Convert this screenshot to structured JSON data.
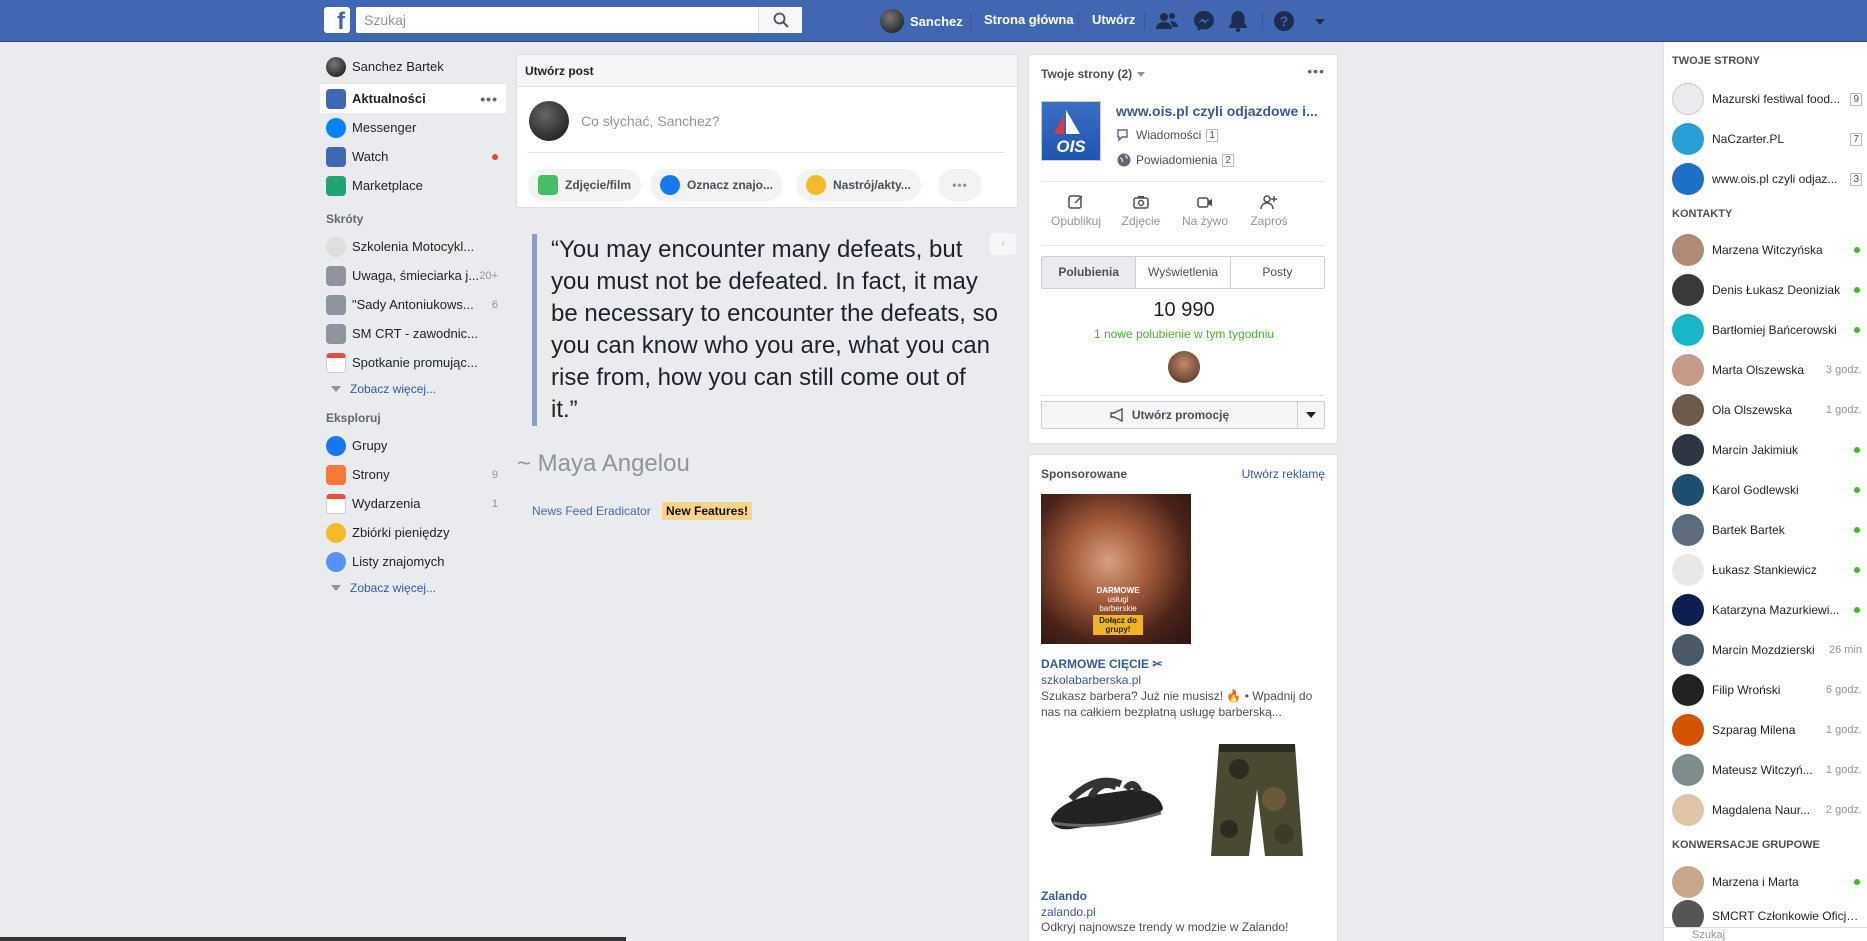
{
  "topbar": {
    "logo": "f",
    "search_placeholder": "Szukaj",
    "user_name": "Sanchez",
    "home": "Strona główna",
    "create": "Utwórz"
  },
  "left_nav": {
    "user": "Sanchez Bartek",
    "main": [
      {
        "label": "Aktualności",
        "more": "•••"
      },
      {
        "label": "Messenger"
      },
      {
        "label": "Watch"
      },
      {
        "label": "Marketplace"
      }
    ],
    "shortcuts_title": "Skróty",
    "shortcuts": [
      {
        "label": "Szkolenia Motocykl...",
        "count": ""
      },
      {
        "label": "Uwaga, śmieciarka j...",
        "count": "20+"
      },
      {
        "label": "\"Sady Antoniukows...",
        "count": "6"
      },
      {
        "label": "SM CRT - zawodnic...",
        "count": ""
      },
      {
        "label": "Spotkanie promując...",
        "count": ""
      }
    ],
    "see_more": "Zobacz więcej...",
    "explore_title": "Eksploruj",
    "explore": [
      {
        "label": "Grupy",
        "count": ""
      },
      {
        "label": "Strony",
        "count": "9"
      },
      {
        "label": "Wydarzenia",
        "count": "1"
      },
      {
        "label": "Zbiórki pieniędzy",
        "count": ""
      },
      {
        "label": "Listy znajomych",
        "count": ""
      }
    ]
  },
  "composer": {
    "title": "Utwórz post",
    "placeholder": "Co słychać, Sanchez?",
    "actions": [
      "Zdjęcie/film",
      "Oznacz znajo...",
      "Nastrój/akty...",
      "•••"
    ]
  },
  "quote": {
    "text": "“You may encounter many defeats, but you must not be defeated. In fact, it may be necessary to encounter the defeats, so you can know who you are, what you can rise from, how you can still come out of it.”",
    "author": "~ Maya Angelou",
    "nfe_link": "News Feed Eradicator",
    "new_features": "New Features!",
    "arrow": "‹"
  },
  "pages_panel": {
    "title": "Twoje strony (2)",
    "page_name": "www.ois.pl czyli odjazdowe i...",
    "messages_label": "Wiadomości",
    "messages_count": "1",
    "notifications_label": "Powiadomienia",
    "notifications_count": "2",
    "actions": [
      "Opublikuj",
      "Zdjęcie",
      "Na żywo",
      "Zaproś"
    ],
    "tabs": [
      "Polubienia",
      "Wyświetlenia",
      "Posty"
    ],
    "likes": "10 990",
    "likes_note": "1 nowe polubienie w tym tygodniu",
    "promote": "Utwórz promocję"
  },
  "ads": {
    "title": "Sponsorowane",
    "create": "Utwórz reklamę",
    "ad1": {
      "title": "DARMOWE CIĘCIE ✂",
      "domain": "szkolabarberska.pl",
      "text": "Szukasz barbera? Już nie musisz! 🔥 • Wpadnij do nas na całkiem bezpłatną usługę barberską...",
      "img_text1": "DARMOWE",
      "img_text2": "usługi",
      "img_text3": "barberskie",
      "img_text4": "Dołącz do grupy!"
    },
    "ad2": {
      "title": "Zalando",
      "domain": "zalando.pl",
      "text": "Odkryj najnowsze trendy w modzie w Zalando!"
    }
  },
  "right_sidebar": {
    "pages_title": "TWOJE STRONY",
    "pages": [
      {
        "name": "Mazurski festiwal food...",
        "count": "9",
        "color": "#e9ebee"
      },
      {
        "name": "NaCzarter.PL",
        "count": "7",
        "color": "#2a9fd6"
      },
      {
        "name": "www.ois.pl czyli odjaz...",
        "count": "3",
        "color": "#1e6fc7"
      }
    ],
    "contacts_title": "KONTAKTY",
    "contacts": [
      {
        "name": "Marzena Witczyńska",
        "time": "",
        "color": "#b08a73"
      },
      {
        "name": "Denis Łukasz Deoniziak",
        "time": "",
        "color": "#3a3a3a"
      },
      {
        "name": "Bartłomiej Bańcerowski",
        "time": "",
        "color": "#19b5c9"
      },
      {
        "name": "Marta Olszewska",
        "time": "3 godz.",
        "color": "#c59a86"
      },
      {
        "name": "Ola Olszewska",
        "time": "1 godz.",
        "color": "#6d5a4a"
      },
      {
        "name": "Marcin Jakimiuk",
        "time": "",
        "color": "#2f3542"
      },
      {
        "name": "Karol Godlewski",
        "time": "",
        "color": "#1e4e6f"
      },
      {
        "name": "Bartek Bartek",
        "time": "",
        "color": "#5d6d7e"
      },
      {
        "name": "Łukasz Stankiewicz",
        "time": "",
        "color": "#e8e8e8"
      },
      {
        "name": "Katarzyna Mazurkiewi...",
        "time": "",
        "color": "#0c1f4f"
      },
      {
        "name": "Marcin Mozdzierski",
        "time": "26 min",
        "color": "#4a5966"
      },
      {
        "name": "Filip Wroński",
        "time": "6 godz.",
        "color": "#222222"
      },
      {
        "name": "Szparag Milena",
        "time": "1 godz.",
        "color": "#d35400"
      },
      {
        "name": "Mateusz Witczyń...",
        "time": "1 godz.",
        "color": "#7f8c8d"
      },
      {
        "name": "Magdalena Naur...",
        "time": "2 godz.",
        "color": "#e0c4a8"
      }
    ],
    "groups_title": "KONWERSACJE GRUPOWE",
    "groups": [
      {
        "name": "Marzena i Marta",
        "time": "",
        "color": "#c9a78a"
      },
      {
        "name": "SMCRT Członkowie Oficjalni...",
        "time": "",
        "color": "#555555"
      }
    ],
    "search_placeholder": "Szukaj"
  }
}
